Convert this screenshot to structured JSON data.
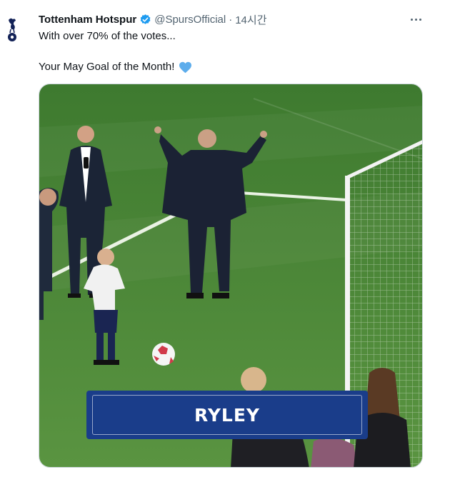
{
  "author": {
    "name": "Tottenham Hotspur",
    "handle": "@SpursOfficial",
    "separator": "·",
    "time": "14시간",
    "verified": true,
    "avatar_icon": "spurs-cockerel-logo"
  },
  "tweet": {
    "line1": "With over 70% of the votes...",
    "line2": "Your May Goal of the Month!",
    "emoji": "blue-heart-icon"
  },
  "media": {
    "caption": "RYLEY"
  },
  "colors": {
    "verified_blue": "#1d9bf0",
    "heart_blue": "#5dadec",
    "caption_bg": "#1a3d8a",
    "pitch_green": "#4f8a3c"
  }
}
